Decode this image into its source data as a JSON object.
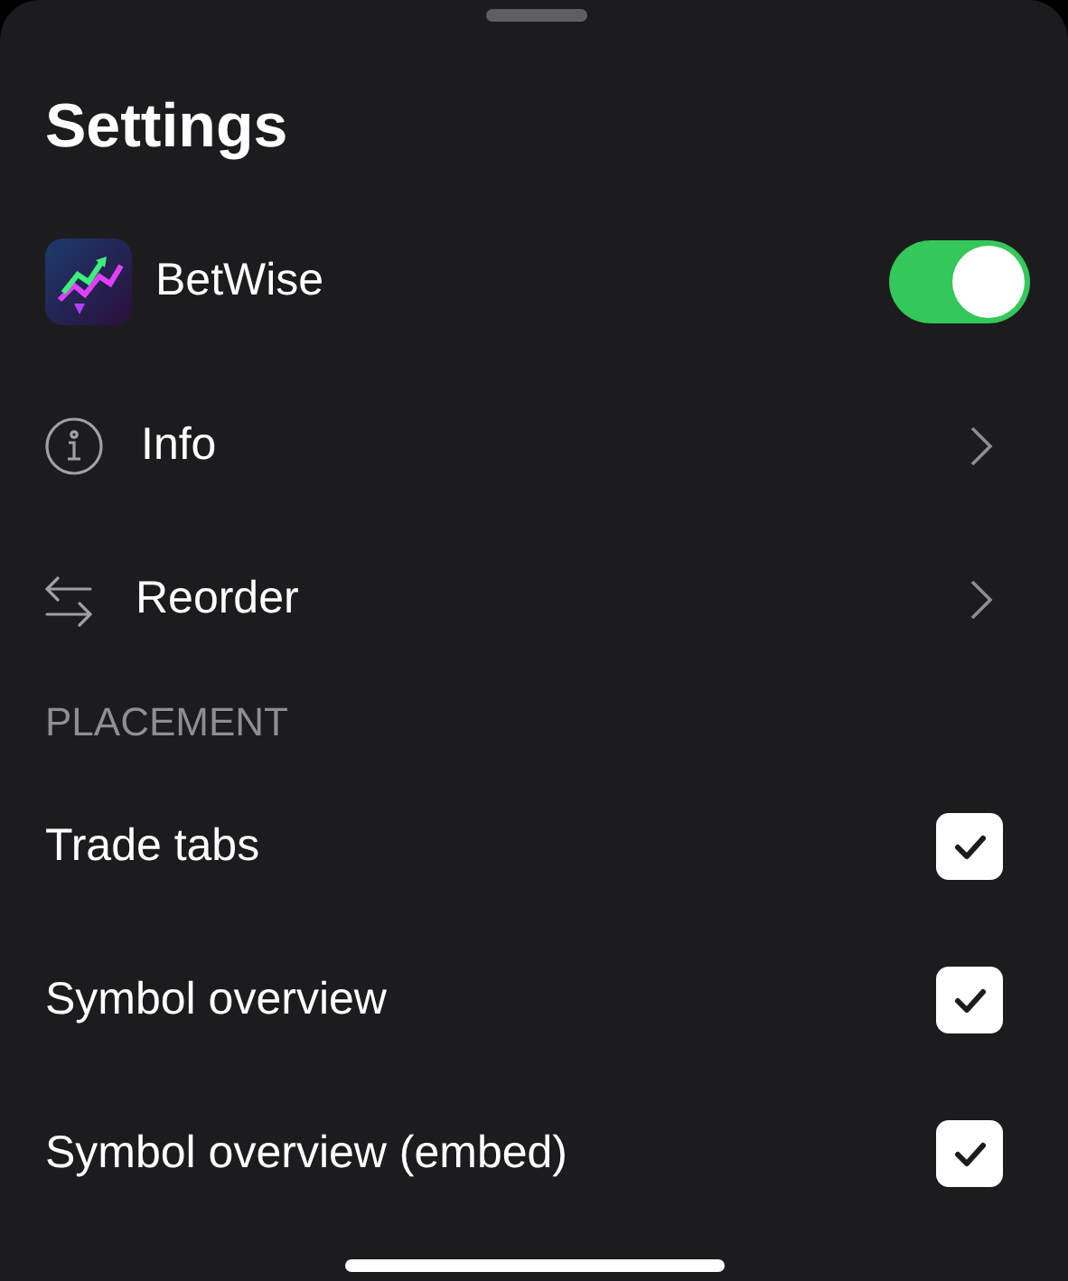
{
  "title": "Settings",
  "app": {
    "name": "BetWise",
    "on": true
  },
  "nav_items": [
    {
      "label": "Info",
      "kind": "info"
    },
    {
      "label": "Reorder",
      "kind": "reorder"
    }
  ],
  "section": {
    "title": "PLACEMENT"
  },
  "options": [
    {
      "label": "Trade tabs",
      "checked": true
    },
    {
      "label": "Symbol overview",
      "checked": true
    },
    {
      "label": "Symbol overview (embed)",
      "checked": true
    }
  ]
}
